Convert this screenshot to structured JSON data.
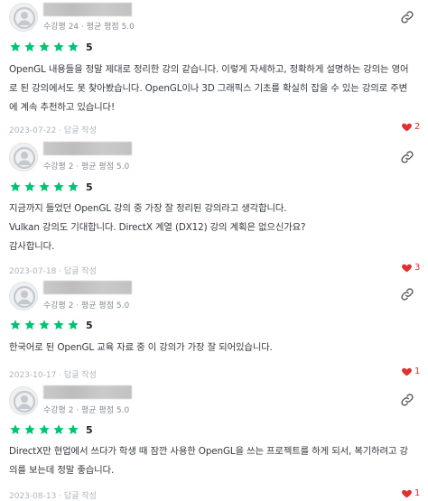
{
  "reviews": [
    {
      "meta": "수강평 24 · 평균 평점 5.0",
      "rating": "5",
      "body": [
        "OpenGL 내용들을 정말 제대로 정리한 강의 같습니다. 이렇게 자세하고, 정확하게 설명하는 강의는 영어",
        "로 된 강의에서도 못 찾아봤습니다. OpenGL이나 3D 그래픽스 기초를 확실히 잡을 수 있는 강의로 주변",
        "에 계속 추천하고 있습니다!"
      ],
      "date": "2023-07-22",
      "reply": "답글 작성",
      "likes": "2"
    },
    {
      "meta": "수강평 2 · 평균 평점 5.0",
      "rating": "5",
      "body": [
        "지금까지 들었던 OpenGL 강의 중 가장 잘 정리된 강의라고 생각합니다.",
        "Vulkan 강의도 기대합니다. DirectX 계열 (DX12) 강의 계획은 없으신가요?",
        "감사합니다."
      ],
      "date": "2023-07-18",
      "reply": "답글 작성",
      "likes": "3"
    },
    {
      "meta": "수강평 2 · 평균 평점 5.0",
      "rating": "5",
      "body": [
        "한국어로 된 OpenGL 교육 자료 중 이 강의가 가장 잘 되어있습니다."
      ],
      "date": "2023-10-17",
      "reply": "답글 작성",
      "likes": "1"
    },
    {
      "meta": "수강평 2 · 평균 평점 5.0",
      "rating": "5",
      "body": [
        "DirectX만 현업에서 쓰다가 학생 때 잠깐 사용한 OpenGL을 쓰는 프로젝트를 하게 되서, 복기하려고 강",
        "의를 보는데 정말 좋습니다."
      ],
      "date": "2023-08-13",
      "reply": "답글 작성",
      "likes": "1"
    }
  ],
  "icons": {
    "star": "star-icon",
    "link": "link-icon",
    "heart": "heart-icon",
    "avatar": "user-avatar"
  },
  "colors": {
    "star": "#00c471",
    "heart": "#e03131",
    "meta": "#868e96"
  }
}
